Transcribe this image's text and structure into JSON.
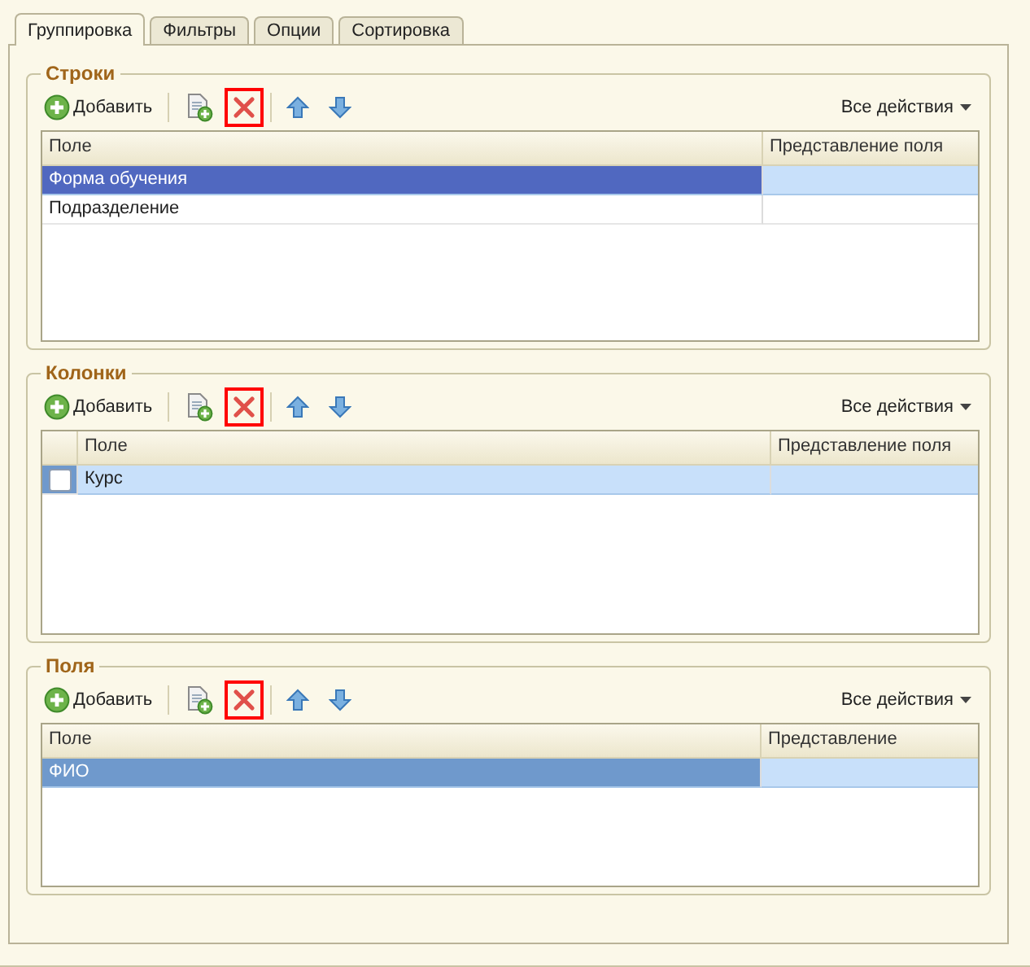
{
  "tabs": [
    {
      "label": "Группировка",
      "selected": true
    },
    {
      "label": "Фильтры",
      "selected": false
    },
    {
      "label": "Опции",
      "selected": false
    },
    {
      "label": "Сортировка",
      "selected": false
    }
  ],
  "groups": [
    {
      "title": "Строки",
      "toolbar": {
        "add": "Добавить",
        "delete_marked": true,
        "all_actions": "Все действия"
      },
      "table": {
        "checkboxes": false,
        "columns": [
          "Поле",
          "Представление поля"
        ],
        "focused": true,
        "rows": [
          {
            "cells": [
              "Форма обучения",
              ""
            ],
            "selected": true,
            "current": true
          },
          {
            "cells": [
              "Подразделение",
              ""
            ],
            "selected": false,
            "current": false
          }
        ]
      }
    },
    {
      "title": "Колонки",
      "toolbar": {
        "add": "Добавить",
        "delete_marked": true,
        "all_actions": "Все действия"
      },
      "table": {
        "checkboxes": true,
        "columns": [
          "Поле",
          "Представление поля"
        ],
        "rows": [
          {
            "cells": [
              "Курс",
              ""
            ],
            "selected": true,
            "current": false,
            "checked": false
          }
        ]
      }
    },
    {
      "title": "Поля",
      "toolbar": {
        "add": "Добавить",
        "delete_marked": true,
        "all_actions": "Все действия"
      },
      "table": {
        "checkboxes": false,
        "columns": [
          "Поле",
          "Представление"
        ],
        "focused": false,
        "rows": [
          {
            "cells": [
              "ФИО",
              ""
            ],
            "selected": true,
            "current": true
          }
        ]
      }
    }
  ]
}
